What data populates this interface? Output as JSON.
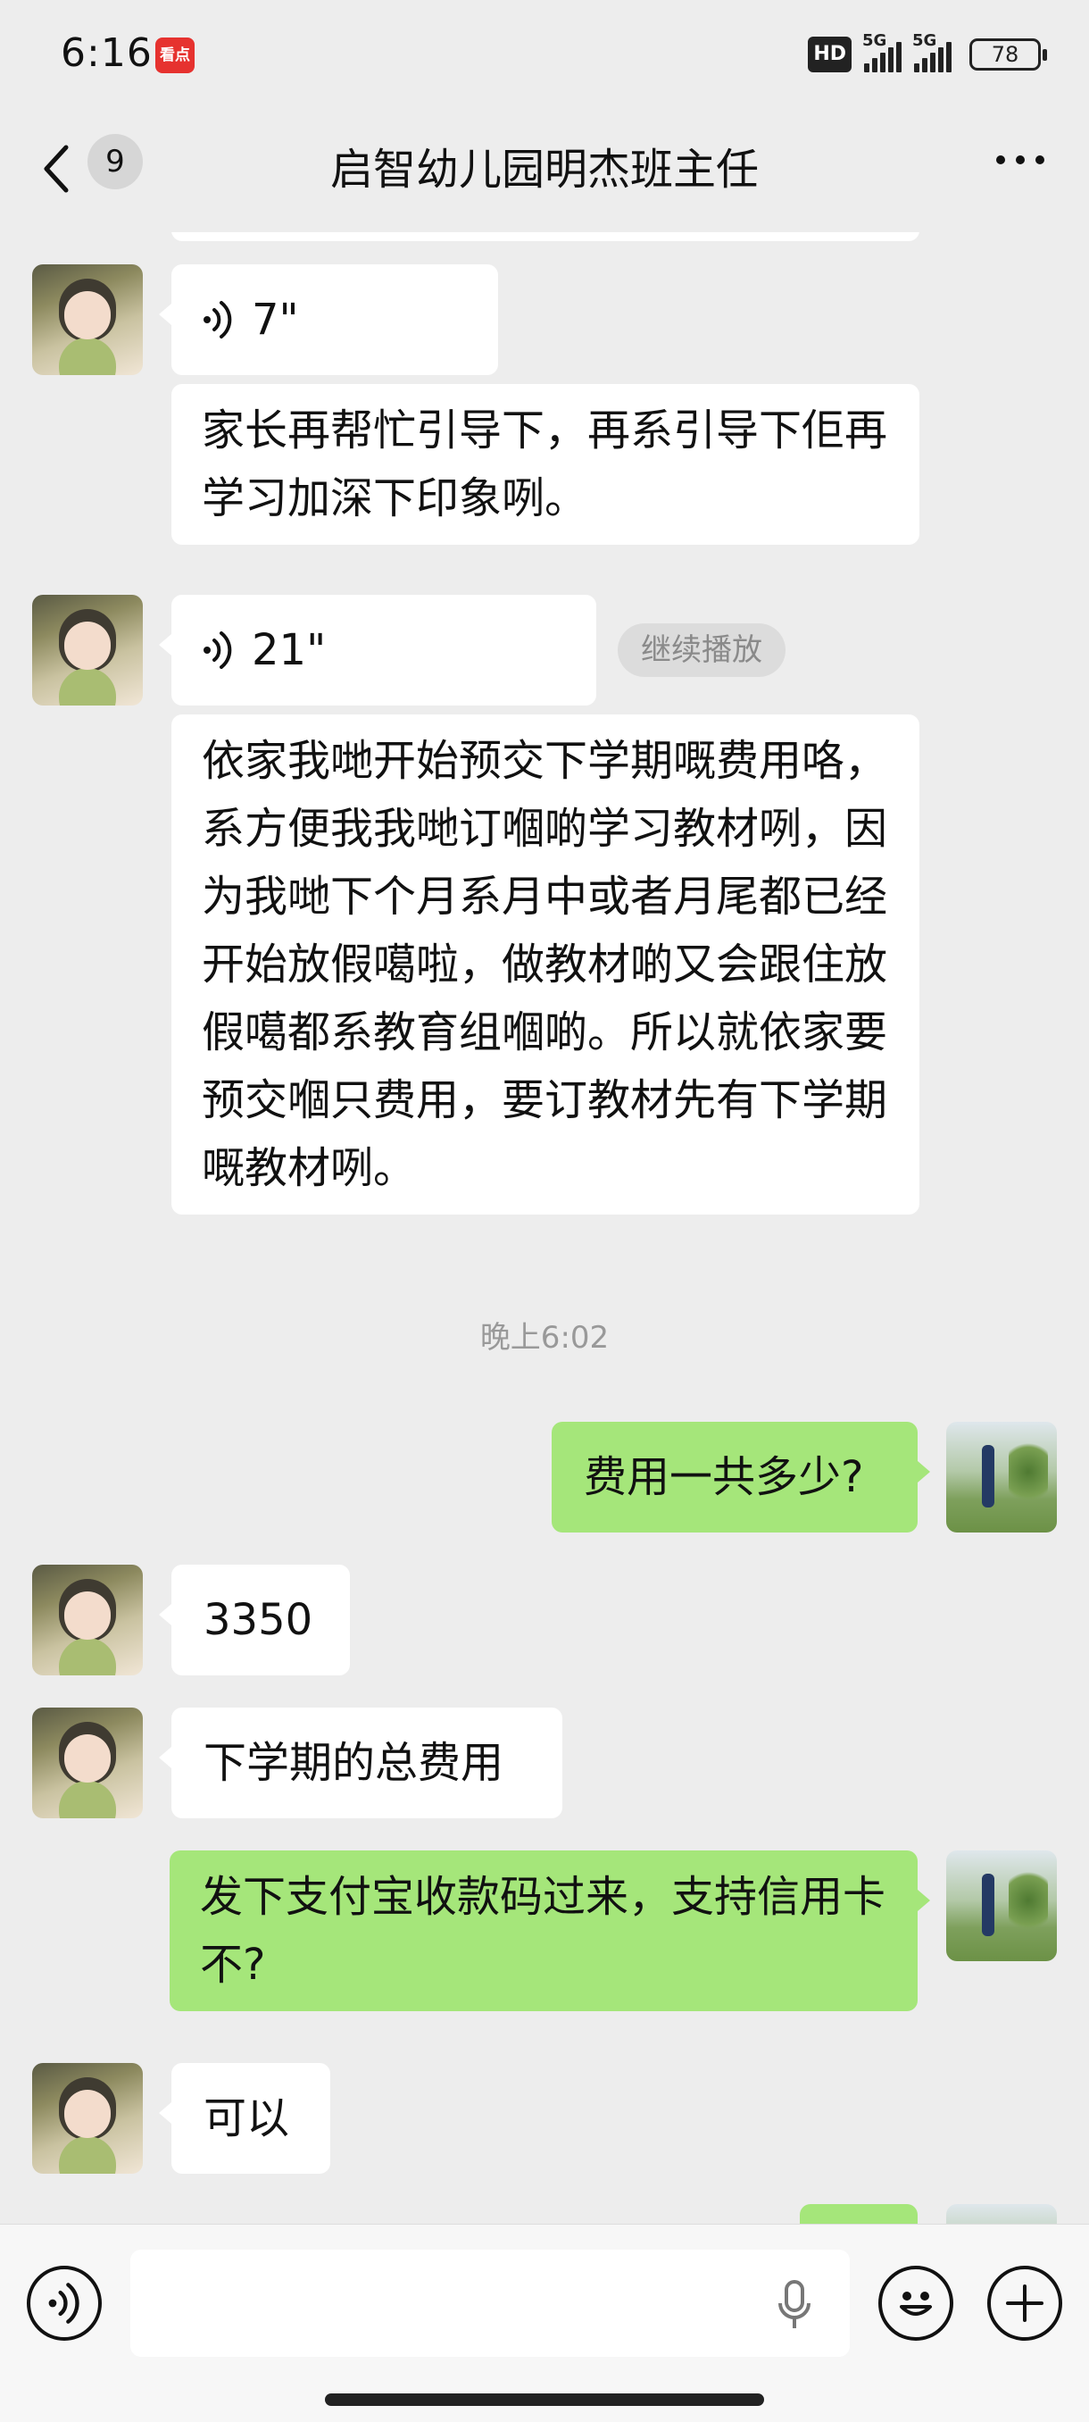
{
  "status_bar": {
    "time": "6:16",
    "app_badge": "看点",
    "hd_label": "HD",
    "sim1": "5G",
    "sim2": "5G",
    "battery": "78"
  },
  "header": {
    "back_count": "9",
    "title": "启智幼儿园明杰班主任"
  },
  "messages": [
    {
      "side": "in",
      "kind": "voice",
      "duration": "7\""
    },
    {
      "side": "in",
      "kind": "text",
      "text": "家长再帮忙引导下，再系引导下佢再学习加深下印象咧。"
    },
    {
      "side": "in",
      "kind": "voice",
      "duration": "21\"",
      "action": "继续播放"
    },
    {
      "side": "in",
      "kind": "text",
      "text": "依家我哋开始预交下学期嘅费用咯，系方便我我哋订嗰啲学习教材咧，因为我哋下个月系月中或者月尾都已经开始放假噶啦，做教材啲又会跟住放假噶都系教育组嗰啲。所以就依家要预交嗰只费用，要订教材先有下学期嘅教材咧。"
    },
    {
      "kind": "timestamp",
      "text": "晚上6:02"
    },
    {
      "side": "out",
      "kind": "text",
      "text": "费用一共多少?"
    },
    {
      "side": "in",
      "kind": "text",
      "text": "3350"
    },
    {
      "side": "in",
      "kind": "text",
      "text": "下学期的总费用"
    },
    {
      "side": "out",
      "kind": "text",
      "text": "发下支付宝收款码过来，支持信用卡不?"
    },
    {
      "side": "in",
      "kind": "text",
      "text": "可以"
    }
  ],
  "input": {
    "placeholder": ""
  },
  "icons": [
    "back-icon",
    "more-icon",
    "voice-wave-icon",
    "voice-mode-icon",
    "mic-icon",
    "emoji-icon",
    "plus-icon"
  ]
}
